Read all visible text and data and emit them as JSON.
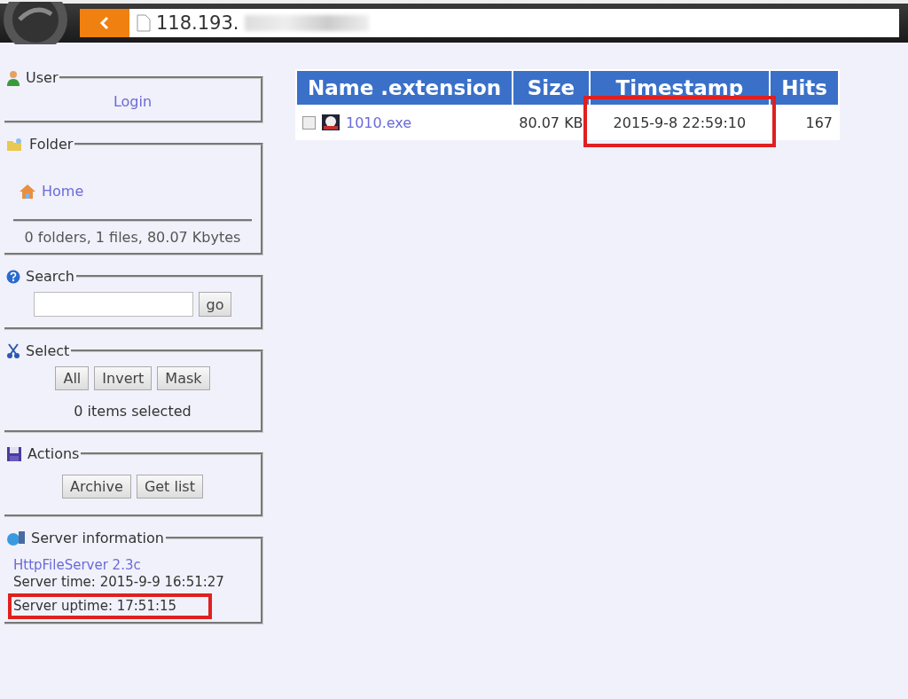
{
  "browser": {
    "address": "118.193."
  },
  "sidebar": [
    {
      "kind": "user",
      "legend": "User",
      "link": "Login"
    },
    {
      "kind": "folder",
      "legend": "Folder",
      "link": "Home",
      "summary": "0 folders, 1 files, 80.07 Kbytes"
    },
    {
      "kind": "search",
      "legend": "Search",
      "button": "go"
    },
    {
      "kind": "select",
      "legend": "Select",
      "buttons": [
        "All",
        "Invert",
        "Mask"
      ],
      "summary": "0 items selected"
    },
    {
      "kind": "actions",
      "legend": "Actions",
      "buttons": [
        "Archive",
        "Get list"
      ]
    },
    {
      "kind": "server",
      "legend": "Server information",
      "link": "HttpFileServer 2.3c",
      "lines": [
        {
          "text": "Server time: 2015-9-9 16:51:27",
          "highlighted": false
        },
        {
          "text": "Server uptime: 17:51:15",
          "highlighted": true
        }
      ]
    }
  ],
  "table": {
    "columns": [
      "Name .extension",
      "Size",
      "Timestamp",
      "Hits"
    ],
    "rows": [
      {
        "checked": false,
        "name": "1010.exe",
        "size": "80.07 KB",
        "timestamp": "2015-9-8 22:59:10",
        "hits": "167",
        "timestamp_highlighted": true
      }
    ]
  }
}
